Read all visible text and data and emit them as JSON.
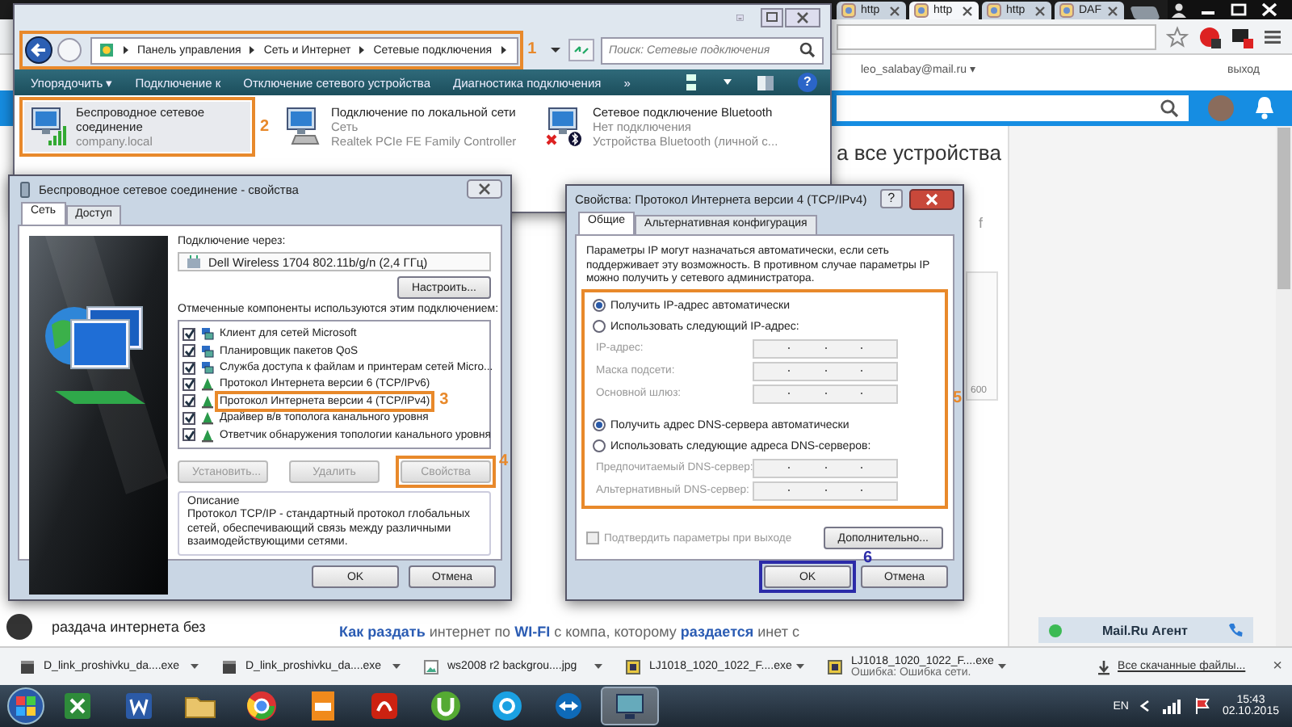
{
  "browser": {
    "tabs": [
      {
        "label": "http",
        "selected": false
      },
      {
        "label": "http",
        "selected": true
      },
      {
        "label": "http",
        "selected": false
      },
      {
        "label": "DAF",
        "selected": false
      }
    ],
    "account": "leo_salabay@mail.ru ▾",
    "logout": "выход",
    "heading": "а все устройства",
    "share_mark": "f",
    "card_value": "600",
    "feed_item": "раздача интернета без",
    "post": "**Как раздать** интернет по **WI-FI** с компа, которому **раздается** инет с",
    "chat": "Mail.Ru Агент"
  },
  "explorer": {
    "breadcrumb": [
      "Панель управления",
      "Сеть и Интернет",
      "Сетевые подключения"
    ],
    "address_annotation": {
      "label": "1",
      "color": "#e8892b"
    },
    "search": {
      "placeholder": "Поиск: Сетевые подключения"
    },
    "help": "?",
    "toolbar": [
      "Упорядочить ▾",
      "Подключение к",
      "Отключение сетевого устройства",
      "Диагностика подключения",
      "»"
    ],
    "connections": [
      {
        "name": "Беспроводное сетевое соединение",
        "status": "company.local",
        "kind": "wireless",
        "selected": true,
        "annotation": {
          "label": "2",
          "color": "#e8892b"
        }
      },
      {
        "name": "Подключение по локальной сети",
        "status": "Сеть",
        "device": "Realtek PCIe FE Family Controller",
        "kind": "wired",
        "selected": false
      },
      {
        "name": "Сетевое подключение Bluetooth",
        "status": "Нет подключения",
        "device": "Устройства Bluetooth (личной с...",
        "kind": "bluetooth",
        "selected": false
      }
    ]
  },
  "properties": {
    "title": "Беспроводное сетевое соединение - свойства",
    "tabs": [
      {
        "label": "Сеть",
        "selected": true
      },
      {
        "label": "Доступ",
        "selected": false
      }
    ],
    "connect_via": "Подключение через:",
    "adapter": "Dell Wireless 1704 802.11b/g/n (2,4 ГГц)",
    "configure": "Настроить...",
    "components_label": "Отмеченные компоненты используются этим подключением:",
    "components": [
      {
        "name": "Клиент для сетей Microsoft",
        "checked": true,
        "kind": "client"
      },
      {
        "name": "Планировщик пакетов QoS",
        "checked": true,
        "kind": "service"
      },
      {
        "name": "Служба доступа к файлам и принтерам сетей Micro...",
        "checked": true,
        "kind": "service"
      },
      {
        "name": "Протокол Интернета версии 6 (TCP/IPv6)",
        "checked": true,
        "kind": "protocol"
      },
      {
        "name": "Протокол Интернета версии 4 (TCP/IPv4)",
        "checked": true,
        "kind": "protocol",
        "annotation": {
          "label": "3",
          "color": "#e8892b"
        }
      },
      {
        "name": "Драйвер в/в тополога канального уровня",
        "checked": true,
        "kind": "protocol"
      },
      {
        "name": "Ответчик обнаружения топологии канального уровня",
        "checked": true,
        "kind": "protocol"
      }
    ],
    "buttons": [
      {
        "label": "Установить...",
        "disabled": true
      },
      {
        "label": "Удалить",
        "disabled": true
      },
      {
        "label": "Свойства",
        "disabled": true,
        "annotation": {
          "label": "4",
          "color": "#e8892b"
        }
      }
    ],
    "description_title": "Описание",
    "description": "Протокол TCP/IP - стандартный протокол глобальных сетей, обеспечивающий связь между различными взаимодействующими сетями.",
    "ok": "OK",
    "cancel": "Отмена"
  },
  "ipv4": {
    "title": "Свойства: Протокол Интернета версии 4 (TCP/IPv4)",
    "help": "?",
    "tabs": [
      {
        "label": "Общие",
        "selected": true
      },
      {
        "label": "Альтернативная конфигурация",
        "selected": false
      }
    ],
    "intro": "Параметры IP могут назначаться автоматически, если сеть поддерживает эту возможность. В противном случае параметры IP можно получить у сетевого администратора.",
    "group_annotation": {
      "label": "5",
      "color": "#e8892b"
    },
    "ip_modes": [
      {
        "label": "Получить IP-адрес автоматически",
        "selected": true
      },
      {
        "label": "Использовать следующий IP-адрес:",
        "selected": false
      }
    ],
    "ip_fields": [
      {
        "label": "IP-адрес:",
        "disabled": true
      },
      {
        "label": "Маска подсети:",
        "disabled": true
      },
      {
        "label": "Основной шлюз:",
        "disabled": true
      }
    ],
    "dns_modes": [
      {
        "label": "Получить адрес DNS-сервера автоматически",
        "selected": true
      },
      {
        "label": "Использовать следующие адреса DNS-серверов:",
        "selected": false
      }
    ],
    "dns_fields": [
      {
        "label": "Предпочитаемый DNS-сервер:",
        "disabled": true
      },
      {
        "label": "Альтернативный DNS-сервер:",
        "disabled": true
      }
    ],
    "confirm": {
      "label": "Подтвердить параметры при выходе",
      "checked": false,
      "disabled": true
    },
    "advanced": "Дополнительно...",
    "ok": "OK",
    "ok_annotation": {
      "label": "6",
      "color": "#2b2ba8"
    },
    "cancel": "Отмена"
  },
  "downloads": {
    "items": [
      {
        "name": "D_link_proshivku_da....exe",
        "kind": "exe"
      },
      {
        "name": "D_link_proshivku_da....exe",
        "kind": "exe"
      },
      {
        "name": "ws2008 r2 backgrou....jpg",
        "kind": "image"
      },
      {
        "name": "LJ1018_1020_1022_F....exe",
        "kind": "installer"
      },
      {
        "name": "LJ1018_1020_1022_F....exe",
        "kind": "installer",
        "status": "Ошибка: Ошибка сети."
      }
    ],
    "show_all": "Все скачанные файлы...",
    "close": "×"
  },
  "taskbar": {
    "apps": [
      {
        "kind": "sheet",
        "selected": false
      },
      {
        "kind": "doc",
        "selected": false
      },
      {
        "kind": "folder",
        "selected": false
      },
      {
        "kind": "browser",
        "selected": false
      },
      {
        "kind": "pdf",
        "selected": false
      },
      {
        "kind": "reader",
        "selected": false
      },
      {
        "kind": "torrent",
        "selected": false
      },
      {
        "kind": "chat",
        "selected": false
      },
      {
        "kind": "remote",
        "selected": false
      },
      {
        "kind": "monitor",
        "selected": true
      }
    ],
    "language": "EN",
    "time": "15:43",
    "date": "02.10.2015"
  }
}
